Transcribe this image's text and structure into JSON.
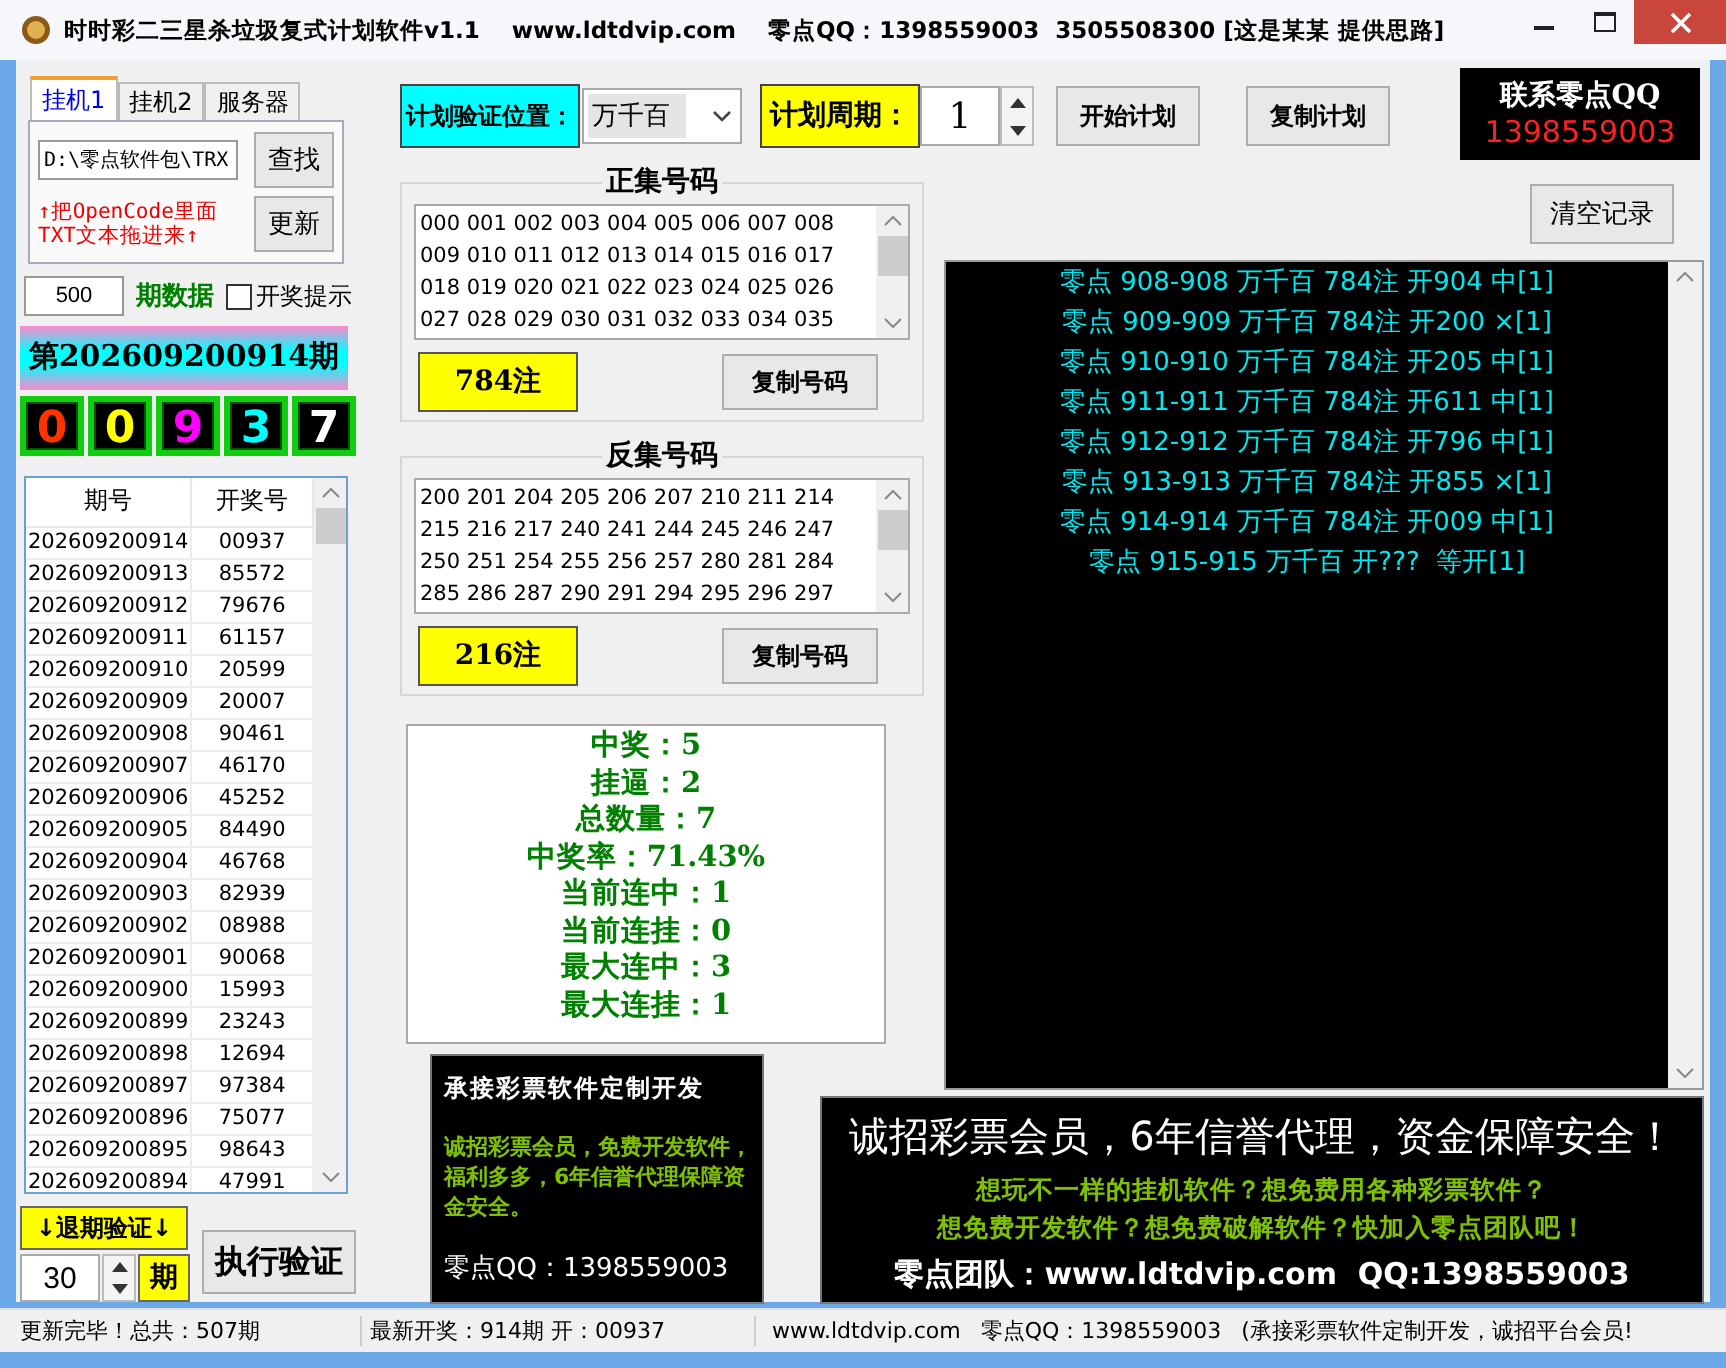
{
  "window": {
    "title": "时时彩二三星杀垃圾复式计划软件v1.1",
    "website": "www.ldtdvip.com",
    "contact": "零点QQ：1398559003  3505508300 [这是某某 提供思路]"
  },
  "tabs": [
    {
      "label": "挂机1",
      "selected": true
    },
    {
      "label": "挂机2",
      "selected": false
    },
    {
      "label": "服务器",
      "selected": false
    }
  ],
  "file_path": "D:\\零点软件包\\TRX",
  "find_button": "查找",
  "drag_hint": "↑把OpenCode里面\nTXT文本拖进来↑",
  "update_button": "更新",
  "period_count": {
    "value": "500",
    "label": "期数据"
  },
  "draw_alert": {
    "label": "开奖提示",
    "checked": false
  },
  "current_issue": "第202609200914期",
  "draw_digits": [
    {
      "digit": "0",
      "color": "#ff3300"
    },
    {
      "digit": "0",
      "color": "#ffff00"
    },
    {
      "digit": "9",
      "color": "#ff00ff"
    },
    {
      "digit": "3",
      "color": "#00ffff"
    },
    {
      "digit": "7",
      "color": "#ffffff"
    }
  ],
  "history_table": {
    "columns": [
      "期号",
      "开奖号"
    ],
    "rows": [
      [
        "202609200914",
        "00937"
      ],
      [
        "202609200913",
        "85572"
      ],
      [
        "202609200912",
        "79676"
      ],
      [
        "202609200911",
        "61157"
      ],
      [
        "202609200910",
        "20599"
      ],
      [
        "202609200909",
        "20007"
      ],
      [
        "202609200908",
        "90461"
      ],
      [
        "202609200907",
        "46170"
      ],
      [
        "202609200906",
        "45252"
      ],
      [
        "202609200905",
        "84490"
      ],
      [
        "202609200904",
        "46768"
      ],
      [
        "202609200903",
        "82939"
      ],
      [
        "202609200902",
        "08988"
      ],
      [
        "202609200901",
        "90068"
      ],
      [
        "202609200900",
        "15993"
      ],
      [
        "202609200899",
        "23243"
      ],
      [
        "202609200898",
        "12694"
      ],
      [
        "202609200897",
        "97384"
      ],
      [
        "202609200896",
        "75077"
      ],
      [
        "202609200895",
        "98643"
      ],
      [
        "202609200894",
        "47991"
      ]
    ]
  },
  "backtest": {
    "button": "↓退期验证↓",
    "periods": "30",
    "unit": "期",
    "run_button": "执行验证"
  },
  "plan": {
    "position_label": "计划验证位置：",
    "position_value": "万千百",
    "cycle_label": "计划周期：",
    "cycle_value": "1",
    "start_button": "开始计划",
    "copy_button": "复制计划"
  },
  "contact_box": {
    "title": "联系零点QQ",
    "qq": "1398559003"
  },
  "number_sets": [
    {
      "title": "正集号码",
      "lines": [
        "000 001 002 003 004 005 006 007 008",
        "009 010 011 012 013 014 015 016 017",
        "018 019 020 021 022 023 024 025 026",
        "027 028 029 030 031 032 033 034 035"
      ],
      "count": "784注",
      "copy_button": "复制号码"
    },
    {
      "title": "反集号码",
      "lines": [
        "200 201 204 205 206 207 210 211 214",
        "215 216 217 240 241 244 245 246 247",
        "250 251 254 255 256 257 280 281 284",
        "285 286 287 290 291 294 295 296 297"
      ],
      "count": "216注",
      "copy_button": "复制号码"
    }
  ],
  "stats": [
    "中奖：5",
    "挂逼：2",
    "总数量：7",
    "中奖率：71.43%",
    "当前连中：1",
    "当前连挂：0",
    "最大连中：3",
    "最大连挂：1"
  ],
  "clear_button": "清空记录",
  "log": [
    "零点 908-908 万千百 784注 开904 中[1]",
    "零点 909-909 万千百 784注 开200 ×[1]",
    "零点 910-910 万千百 784注 开205 中[1]",
    "零点 911-911 万千百 784注 开611 中[1]",
    "零点 912-912 万千百 784注 开796 中[1]",
    "零点 913-913 万千百 784注 开855 ×[1]",
    "零点 914-914 万千百 784注 开009 中[1]",
    "零点 915-915 万千百 开???  等开[1]"
  ],
  "ad_small": {
    "title": "承接彩票软件定制开发",
    "body": "诚招彩票会员，免费开发软件，福利多多，6年信誉代理保障资金安全。",
    "contact": "零点QQ：1398559003"
  },
  "ad_large": {
    "headline": "诚招彩票会员，6年信誉代理，资金保障安全！",
    "lines": [
      "想玩不一样的挂机软件？想免费用各种彩票软件？",
      "想免费开发软件？想免费破解软件？快加入零点团队吧！"
    ],
    "contact": "零点团队：www.ldtdvip.com  QQ:1398559003"
  },
  "status_bar": [
    "更新完毕！总共：507期",
    "最新开奖：914期 开：00937",
    "www.ldtdvip.com",
    "零点QQ：1398559003",
    "(承接彩票软件定制开发，诚招平台会员!"
  ]
}
